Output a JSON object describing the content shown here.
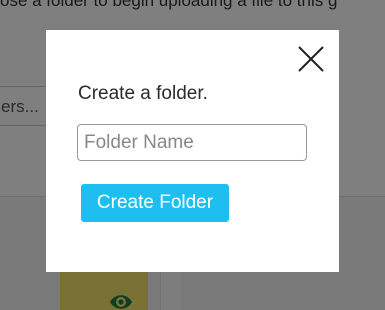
{
  "background": {
    "header_text": "ose a folder to begin uploading a file to this g",
    "search_placeholder": "ers..."
  },
  "modal": {
    "close_icon": "close-icon",
    "title": "Create a folder.",
    "input": {
      "value": "",
      "placeholder": "Folder Name"
    },
    "create_button_label": "Create Folder",
    "accent_color": "#1ebff0"
  },
  "icons": {
    "eye": "eye-icon"
  }
}
